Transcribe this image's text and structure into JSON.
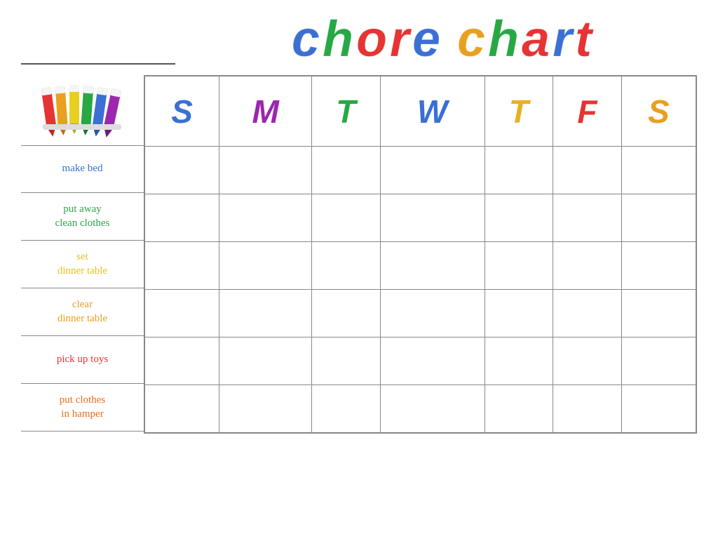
{
  "header": {
    "title": "chore chart",
    "name_line_placeholder": ""
  },
  "days": {
    "headers": [
      {
        "label": "S",
        "color_class": "day-s1",
        "id": "sunday"
      },
      {
        "label": "M",
        "color_class": "day-m",
        "id": "monday"
      },
      {
        "label": "T",
        "color_class": "day-t1",
        "id": "tuesday"
      },
      {
        "label": "W",
        "color_class": "day-w",
        "id": "wednesday"
      },
      {
        "label": "T",
        "color_class": "day-t2",
        "id": "thursday"
      },
      {
        "label": "F",
        "color_class": "day-f",
        "id": "friday"
      },
      {
        "label": "S",
        "color_class": "day-s2",
        "id": "saturday"
      }
    ]
  },
  "chores": [
    {
      "label": "make bed",
      "color_class": "chore-make-bed",
      "id": "make-bed"
    },
    {
      "label": "put away\nclean clothes",
      "color_class": "chore-put-away",
      "id": "put-away-clothes"
    },
    {
      "label": "set\ndinner table",
      "color_class": "chore-set-dinner",
      "id": "set-dinner-table"
    },
    {
      "label": "clear\ndinner table",
      "color_class": "chore-clear-dinner",
      "id": "clear-dinner-table"
    },
    {
      "label": "pick up toys",
      "color_class": "chore-pick-up",
      "id": "pick-up-toys"
    },
    {
      "label": "put clothes\nin hamper",
      "color_class": "chore-put-clothes",
      "id": "put-clothes-hamper"
    }
  ],
  "crayons": {
    "colors": [
      "#e63333",
      "#e8a020",
      "#e8d020",
      "#27a844",
      "#3b6fd4",
      "#9b27af"
    ]
  }
}
